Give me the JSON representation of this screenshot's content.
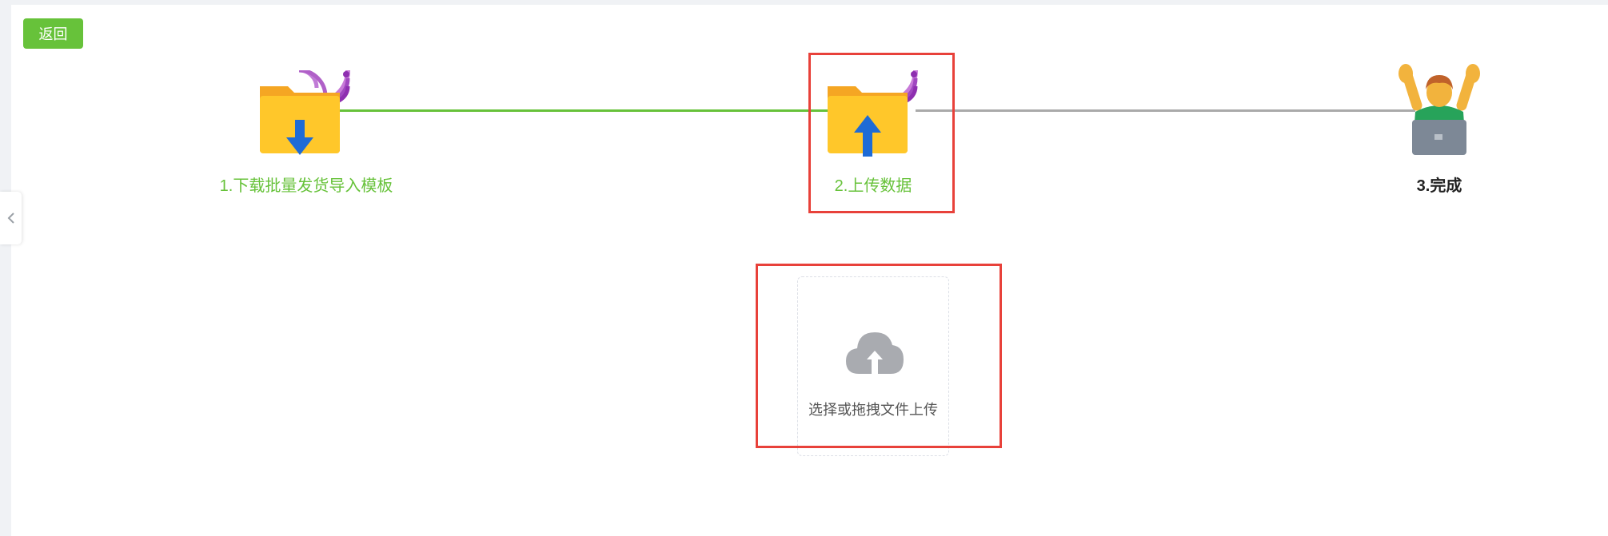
{
  "header": {
    "back_label": "返回"
  },
  "steps": [
    {
      "label": "1.下载批量发货导入模板",
      "icon": "folder-download-icon",
      "status": "done"
    },
    {
      "label": "2.上传数据",
      "icon": "folder-upload-icon",
      "status": "active"
    },
    {
      "label": "3.完成",
      "icon": "celebrating-person-laptop-icon",
      "status": "pending"
    }
  ],
  "upload": {
    "hint": "选择或拖拽文件上传",
    "icon": "cloud-upload-icon"
  },
  "colors": {
    "accent": "#67c23a",
    "highlight": "#e8413a",
    "pending_line": "#aaaaaa"
  }
}
